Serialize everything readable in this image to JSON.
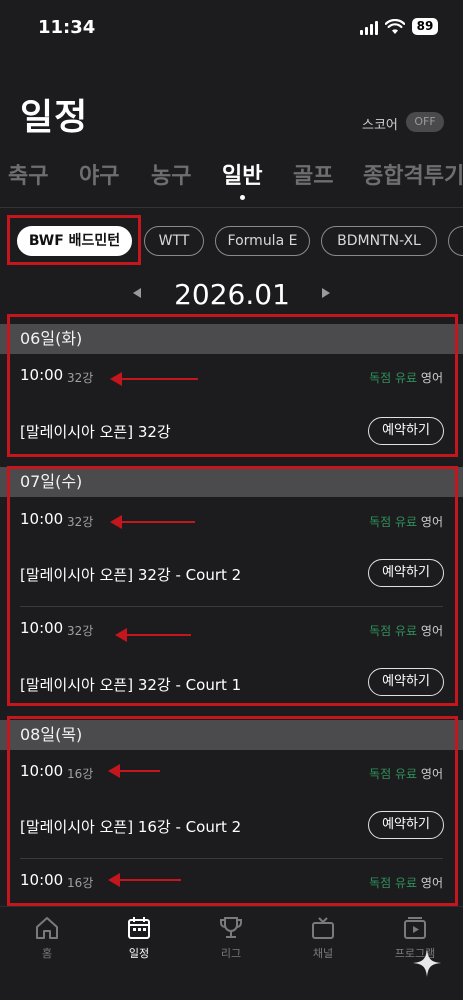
{
  "status": {
    "time": "11:34",
    "battery": "89"
  },
  "header": {
    "title": "일정",
    "score_label": "스코어",
    "score_toggle": "OFF"
  },
  "tabs": [
    "축구",
    "야구",
    "농구",
    "일반",
    "골프",
    "종합격투기"
  ],
  "active_tab": "일반",
  "chips": [
    "BWF 배드민턴",
    "WTT",
    "Formula E",
    "BDMNTN-XL"
  ],
  "month": "2026.01",
  "days": [
    {
      "header": "06일(화)",
      "matches": [
        {
          "time": "10:00",
          "round": "32강",
          "tag1": "독점",
          "tag2": "유료",
          "lang": "영어",
          "title": "[말레이시아 오픈] 32강",
          "button": "예약하기"
        }
      ]
    },
    {
      "header": "07일(수)",
      "matches": [
        {
          "time": "10:00",
          "round": "32강",
          "tag1": "독점",
          "tag2": "유료",
          "lang": "영어",
          "title": "[말레이시아 오픈] 32강 - Court 2",
          "button": "예약하기"
        },
        {
          "time": "10:00",
          "round": "32강",
          "tag1": "독점",
          "tag2": "유료",
          "lang": "영어",
          "title": "[말레이시아 오픈] 32강 - Court 1",
          "button": "예약하기"
        }
      ]
    },
    {
      "header": "08일(목)",
      "matches": [
        {
          "time": "10:00",
          "round": "16강",
          "tag1": "독점",
          "tag2": "유료",
          "lang": "영어",
          "title": "[말레이시아 오픈] 16강 - Court 2",
          "button": "예약하기"
        },
        {
          "time": "10:00",
          "round": "16강",
          "tag1": "독점",
          "tag2": "유료",
          "lang": "영어"
        }
      ]
    }
  ],
  "bottom_nav": [
    {
      "label": "홈",
      "icon": "home-icon"
    },
    {
      "label": "일정",
      "icon": "calendar-icon",
      "active": true
    },
    {
      "label": "리그",
      "icon": "trophy-icon"
    },
    {
      "label": "채널",
      "icon": "tv-icon"
    },
    {
      "label": "프로그램",
      "icon": "program-icon"
    }
  ],
  "colors": {
    "background": "#1c1c1e",
    "highlight_red": "#c4161c",
    "tag_green": "#2f8f5a",
    "day_header": "#4b4b4d"
  }
}
